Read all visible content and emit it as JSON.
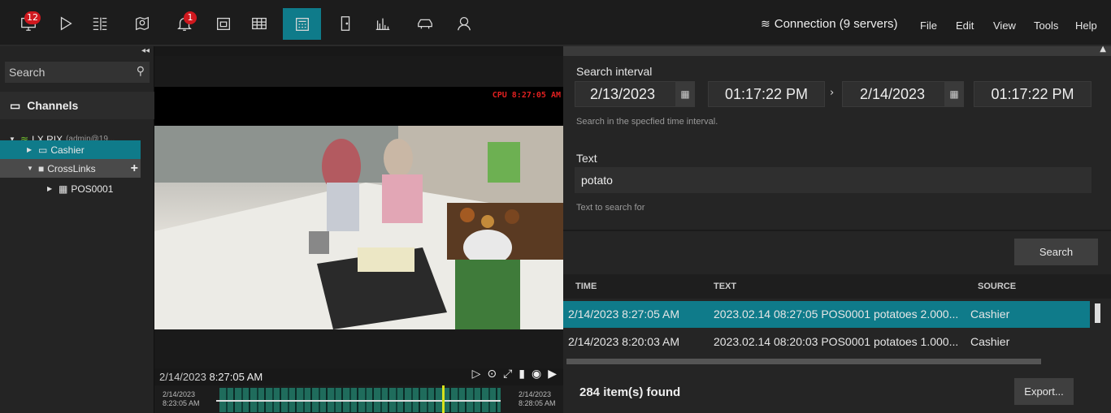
{
  "toolbar": {
    "monitor_badge": "12",
    "alerts_badge": "1",
    "connection_label": "Connection (9 servers)",
    "menu": [
      "File",
      "Edit",
      "View",
      "Tools",
      "Help"
    ],
    "active_color": "#0f7b8a"
  },
  "sidebar": {
    "search_placeholder": "Search",
    "channels_title": "Channels",
    "server_name": "LX RIX",
    "server_user": "(admin@19...",
    "items": [
      {
        "label": "Cashier"
      },
      {
        "label": "CrossLinks"
      },
      {
        "label": "POS0001"
      }
    ]
  },
  "video": {
    "cpu_overlay": "CPU 8:27:05 AM",
    "date": "2/14/2023",
    "time": "8:27:05 AM",
    "timeline_start_date": "2/14/2023",
    "timeline_start_time": "8:23:05 AM",
    "timeline_end_date": "2/14/2023",
    "timeline_end_time": "8:28:05 AM"
  },
  "search": {
    "interval_label": "Search interval",
    "from_date": "2/13/2023",
    "from_time": "01:17:22 PM",
    "to_date": "2/14/2023",
    "to_time": "01:17:22 PM",
    "interval_hint": "Search in the specfied time interval.",
    "text_label": "Text",
    "text_value": "potato",
    "text_hint": "Text to search for",
    "search_button": "Search"
  },
  "results": {
    "columns": [
      "TIME",
      "TEXT",
      "SOURCE"
    ],
    "rows": [
      {
        "time": "2/14/2023 8:27:05 AM",
        "text": "2023.02.14 08:27:05 POS0001 potatoes 2.000...",
        "source": "Cashier"
      },
      {
        "time": "2/14/2023 8:20:03 AM",
        "text": "2023.02.14 08:20:03 POS0001 potatoes 1.000...",
        "source": "Cashier"
      }
    ],
    "found": "284 item(s) found",
    "export_button": "Export..."
  }
}
